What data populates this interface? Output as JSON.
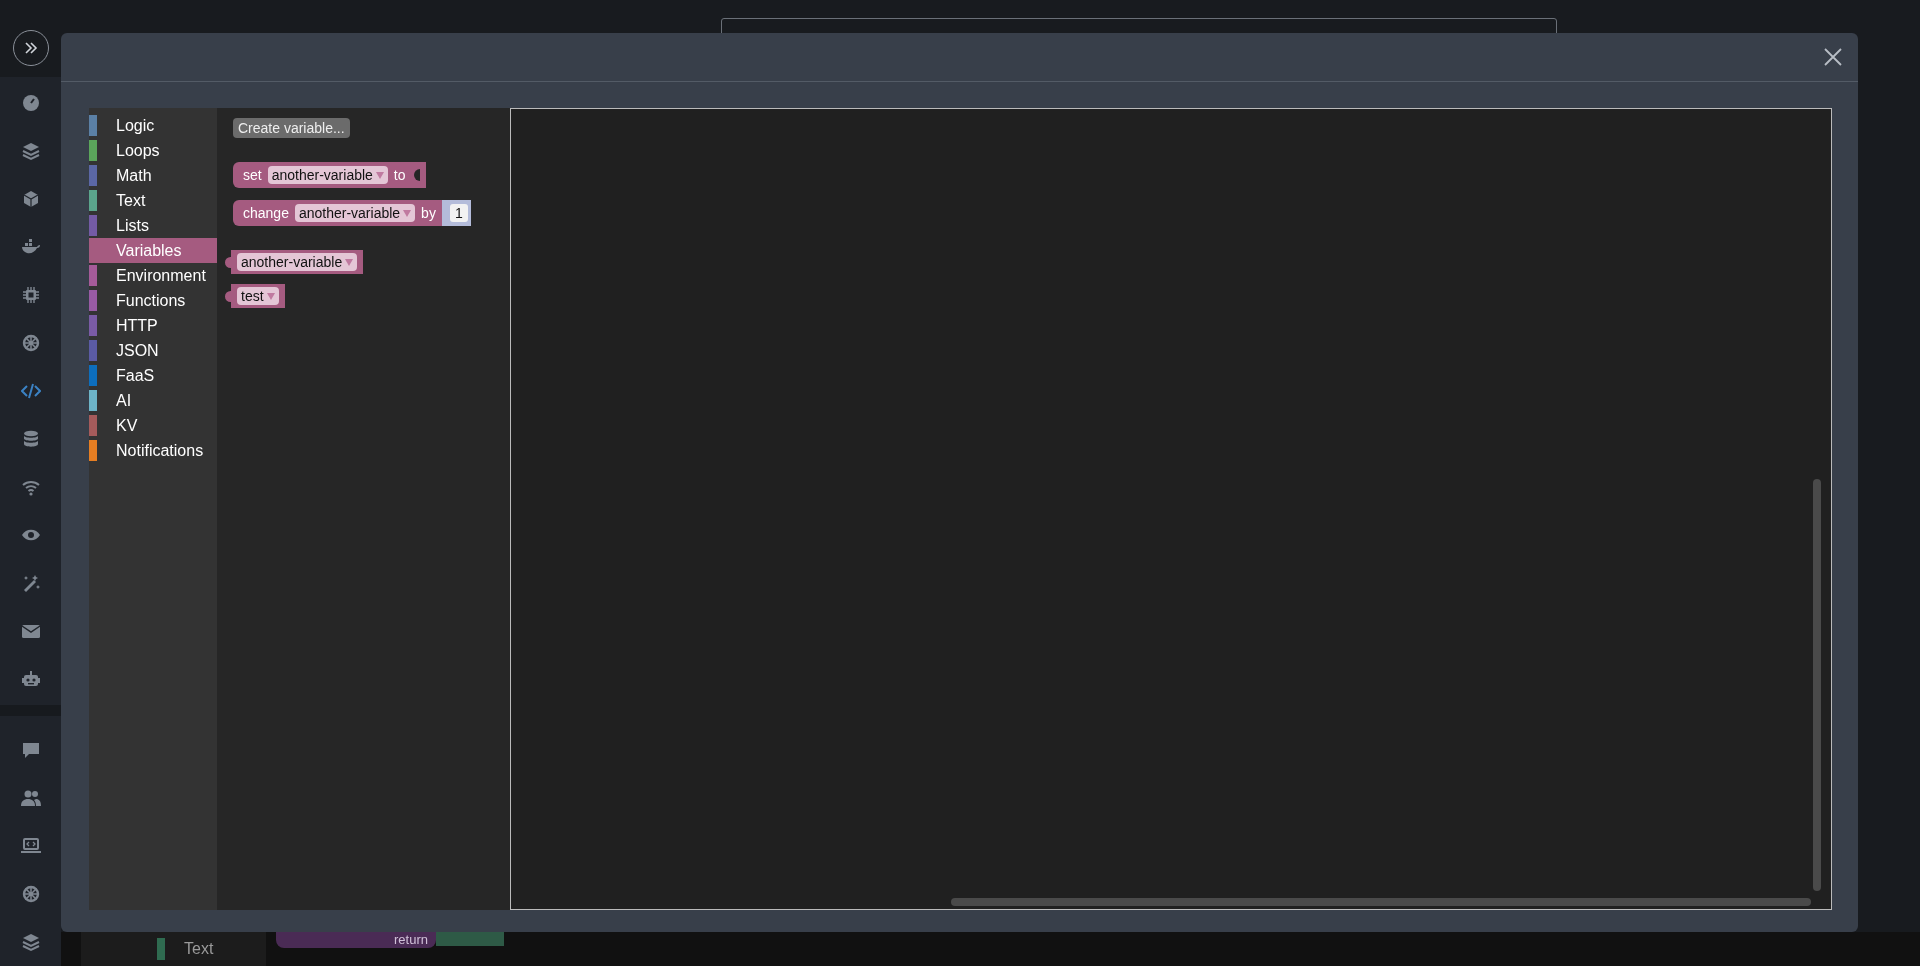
{
  "sidebar": {
    "items": [
      {
        "selected": false
      },
      {
        "selected": false
      },
      {
        "selected": false
      },
      {
        "selected": false
      },
      {
        "selected": false
      },
      {
        "selected": false
      },
      {
        "selected": true
      },
      {
        "selected": false
      },
      {
        "selected": false
      },
      {
        "selected": false
      },
      {
        "selected": false
      },
      {
        "selected": false
      },
      {
        "selected": false
      }
    ],
    "lower_items": [
      {
        "selected": false
      },
      {
        "selected": false
      },
      {
        "selected": false
      },
      {
        "selected": false
      },
      {
        "selected": false
      }
    ]
  },
  "background": {
    "category": {
      "label": "Text",
      "color": "#2f6b50"
    },
    "block": {
      "label": "return"
    }
  },
  "modal": {
    "toolbox": [
      {
        "label": "Logic",
        "color": "#5b80a5",
        "selected": false
      },
      {
        "label": "Loops",
        "color": "#5ba55b",
        "selected": false
      },
      {
        "label": "Math",
        "color": "#5b67a5",
        "selected": false
      },
      {
        "label": "Text",
        "color": "#5ba58c",
        "selected": false
      },
      {
        "label": "Lists",
        "color": "#745ba5",
        "selected": false
      },
      {
        "label": "Variables",
        "color": "#a55b80",
        "selected": true
      },
      {
        "label": "Environment",
        "color": "#a55b99",
        "selected": false
      },
      {
        "label": "Functions",
        "color": "#995ba5",
        "selected": false
      },
      {
        "label": "HTTP",
        "color": "#7a5ba5",
        "selected": false
      },
      {
        "label": "JSON",
        "color": "#5b5ba5",
        "selected": false
      },
      {
        "label": "FaaS",
        "color": "#0d6ebd",
        "selected": false
      },
      {
        "label": "AI",
        "color": "#6db4c8",
        "selected": false
      },
      {
        "label": "KV",
        "color": "#a55b5b",
        "selected": false
      },
      {
        "label": "Notifications",
        "color": "#e67e22",
        "selected": false
      }
    ],
    "flyout": {
      "button": "Create variable...",
      "blocks": [
        {
          "kind": "set",
          "label": "set",
          "variable": "another-variable",
          "suffix": "to"
        },
        {
          "kind": "change",
          "label": "change",
          "variable": "another-variable",
          "suffix": "by",
          "value": "1"
        },
        {
          "kind": "get",
          "variable": "another-variable"
        },
        {
          "kind": "get",
          "variable": "test"
        }
      ]
    }
  }
}
